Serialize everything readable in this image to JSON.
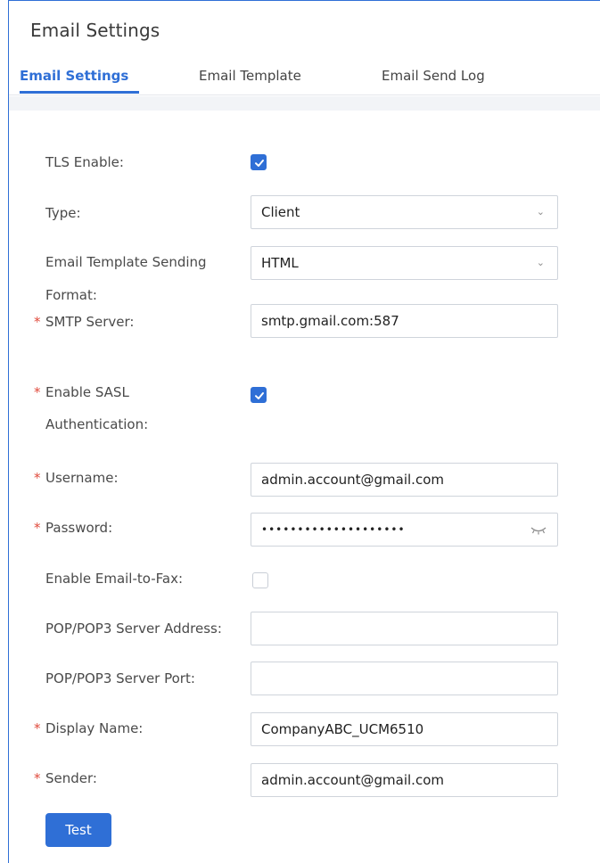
{
  "page": {
    "title": "Email Settings"
  },
  "tabs": [
    {
      "label": "Email Settings",
      "active": true
    },
    {
      "label": "Email Template",
      "active": false
    },
    {
      "label": "Email Send Log",
      "active": false
    }
  ],
  "form": {
    "tls_enable": {
      "label": "TLS Enable:",
      "checked": true
    },
    "type": {
      "label": "Type:",
      "value": "Client"
    },
    "template_format": {
      "label_line1": "Email Template Sending",
      "label_line2": "Format:",
      "value": "HTML"
    },
    "smtp_server": {
      "label": "SMTP Server:",
      "required": "*",
      "value": "smtp.gmail.com:587"
    },
    "enable_sasl": {
      "label_line1": "Enable SASL",
      "label_line2": "Authentication:",
      "required": "*",
      "checked": true
    },
    "username": {
      "label": "Username:",
      "required": "*",
      "value": "admin.account@gmail.com"
    },
    "password": {
      "label": "Password:",
      "required": "*",
      "value": "••••••••••••••••••••"
    },
    "email_to_fax": {
      "label": "Enable Email-to-Fax:",
      "checked": false
    },
    "pop_address": {
      "label": "POP/POP3 Server Address:",
      "value": ""
    },
    "pop_port": {
      "label": "POP/POP3 Server Port:",
      "value": ""
    },
    "display_name": {
      "label": "Display Name:",
      "required": "*",
      "value": "CompanyABC_UCM6510"
    },
    "sender": {
      "label": "Sender:",
      "required": "*",
      "value": "admin.account@gmail.com"
    }
  },
  "actions": {
    "test_label": "Test"
  },
  "colors": {
    "accent": "#2f6fd6",
    "required": "#e04a3c"
  },
  "icons": {
    "select": "chevron-down-icon",
    "password_toggle": "eye-closed-icon",
    "check": "check-icon"
  }
}
